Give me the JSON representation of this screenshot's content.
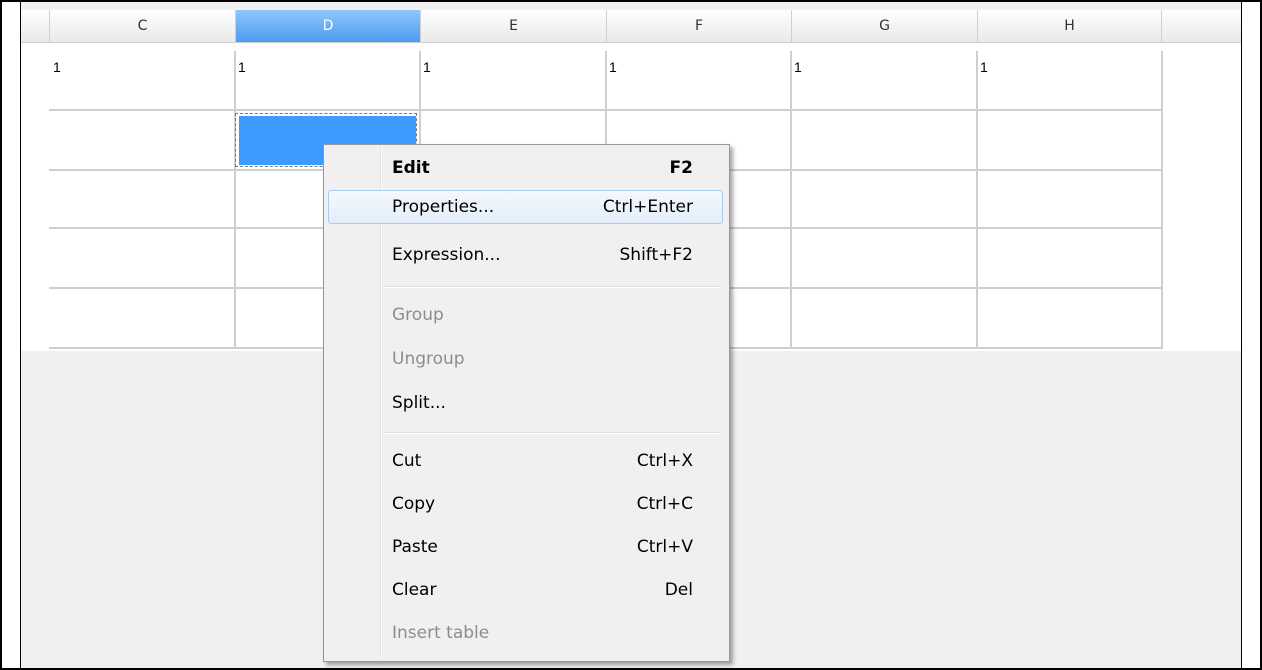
{
  "columns": [
    "C",
    "D",
    "E",
    "F",
    "G",
    "H"
  ],
  "selected_column": "D",
  "rows": [
    [
      "1",
      "1",
      "1",
      "1",
      "1",
      "1"
    ],
    [
      "",
      "",
      "",
      "",
      "",
      ""
    ],
    [
      "",
      "",
      "",
      "",
      "",
      ""
    ],
    [
      "",
      "",
      "",
      "",
      "",
      ""
    ],
    [
      "",
      "",
      "",
      "",
      "",
      ""
    ]
  ],
  "colors": {
    "selection_fill": "#3d9bff",
    "header_selected": "#4a9cf1",
    "menu_hover_border": "#a8cbf1"
  },
  "context_menu": {
    "items": [
      {
        "label": "Edit",
        "shortcut": "F2",
        "bold": true
      },
      {
        "label": "Properties...",
        "shortcut": "Ctrl+Enter",
        "highlighted": true
      },
      {
        "label": "Expression...",
        "shortcut": "Shift+F2"
      },
      {
        "label": "Group",
        "shortcut": "",
        "disabled": true
      },
      {
        "label": "Ungroup",
        "shortcut": "",
        "disabled": true
      },
      {
        "label": "Split...",
        "shortcut": ""
      },
      {
        "label": "Cut",
        "shortcut": "Ctrl+X"
      },
      {
        "label": "Copy",
        "shortcut": "Ctrl+C"
      },
      {
        "label": "Paste",
        "shortcut": "Ctrl+V"
      },
      {
        "label": "Clear",
        "shortcut": "Del"
      },
      {
        "label": "Insert table",
        "shortcut": "",
        "disabled": true
      }
    ]
  }
}
